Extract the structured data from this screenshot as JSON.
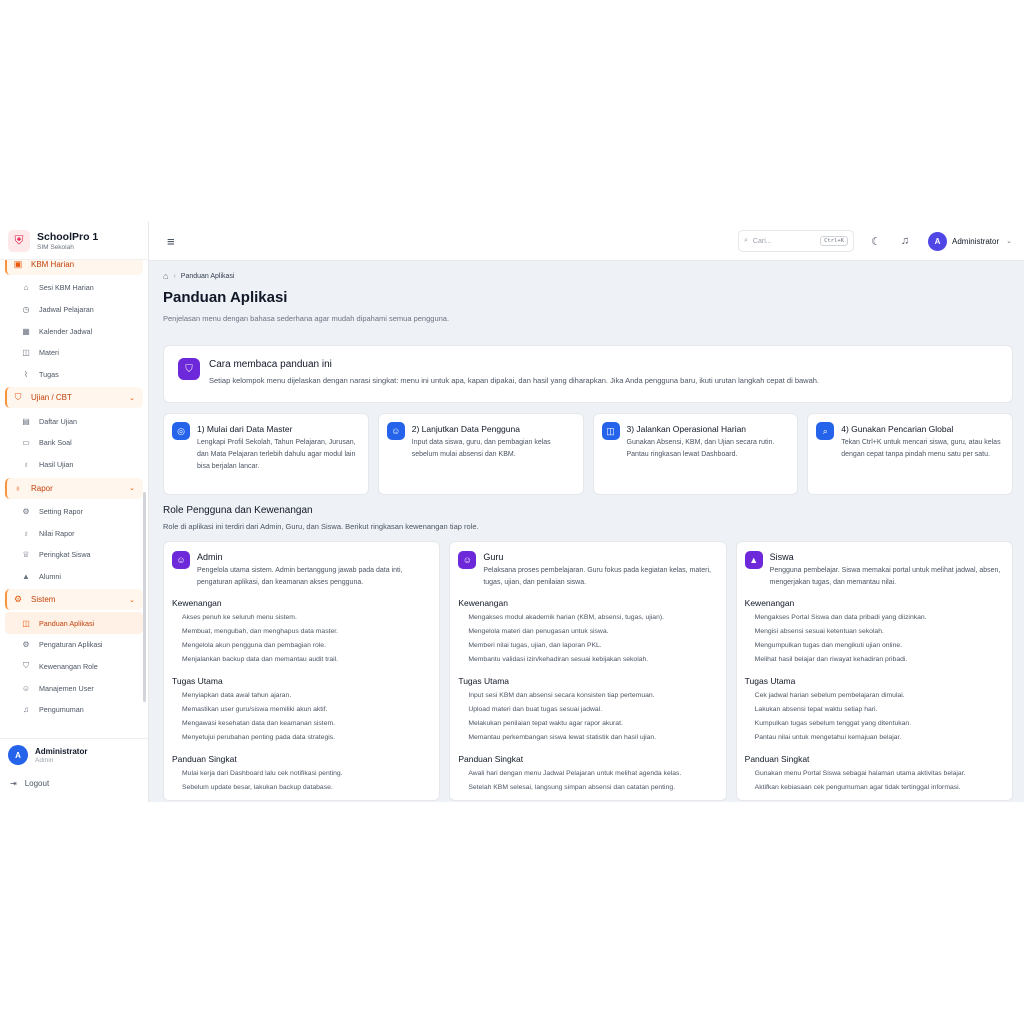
{
  "brand": {
    "title": "SchoolPro 1",
    "subtitle": "SIM Sekolah"
  },
  "sidebar": {
    "group_kbm": "KBM Harian",
    "kbm_items": [
      {
        "label": "Sesi KBM Harian",
        "icon": "home-icon"
      },
      {
        "label": "Jadwal Pelajaran",
        "icon": "clock-icon"
      },
      {
        "label": "Kalender Jadwal",
        "icon": "calendar-icon"
      },
      {
        "label": "Materi",
        "icon": "book-icon"
      },
      {
        "label": "Tugas",
        "icon": "paperclip-icon"
      }
    ],
    "group_ujian": "Ujian / CBT",
    "ujian_items": [
      {
        "label": "Daftar Ujian",
        "icon": "file-icon"
      },
      {
        "label": "Bank Soal",
        "icon": "folder-icon"
      },
      {
        "label": "Hasil Ujian",
        "icon": "award-icon"
      }
    ],
    "group_rapor": "Rapor",
    "rapor_items": [
      {
        "label": "Setting Rapor",
        "icon": "gear-icon"
      },
      {
        "label": "Nilai Rapor",
        "icon": "award-icon"
      },
      {
        "label": "Peringkat Siswa",
        "icon": "trophy-icon"
      },
      {
        "label": "Alumni",
        "icon": "graduation-icon"
      }
    ],
    "group_sistem": "Sistem",
    "sistem_items": [
      {
        "label": "Panduan Aplikasi",
        "icon": "book-icon"
      },
      {
        "label": "Pengaturan Aplikasi",
        "icon": "gear-icon"
      },
      {
        "label": "Kewenangan Role",
        "icon": "shield-icon"
      },
      {
        "label": "Manajemen User",
        "icon": "users-icon"
      },
      {
        "label": "Pengumuman",
        "icon": "bell-icon"
      }
    ],
    "user": {
      "initial": "A",
      "name": "Administrator",
      "role": "Admin"
    },
    "logout": "Logout"
  },
  "topbar": {
    "search_placeholder": "Cari...",
    "shortcut": "Ctrl+K",
    "user_initial": "A",
    "user_name": "Administrator"
  },
  "breadcrumb": {
    "current": "Panduan Aplikasi"
  },
  "page": {
    "title": "Panduan Aplikasi",
    "subtitle": "Penjelasan menu dengan bahasa sederhana agar mudah dipahami semua pengguna."
  },
  "intro": {
    "title": "Cara membaca panduan ini",
    "text": "Setiap kelompok menu dijelaskan dengan narasi singkat: menu ini untuk apa, kapan dipakai, dan hasil yang diharapkan. Jika Anda pengguna baru, ikuti urutan langkah cepat di bawah."
  },
  "steps": [
    {
      "title": "1) Mulai dari Data Master",
      "text": "Lengkapi Profil Sekolah, Tahun Pelajaran, Jurusan, dan Mata Pelajaran terlebih dahulu agar modul lain bisa berjalan lancar."
    },
    {
      "title": "2) Lanjutkan Data Pengguna",
      "text": "Input data siswa, guru, dan pembagian kelas sebelum mulai absensi dan KBM."
    },
    {
      "title": "3) Jalankan Operasional Harian",
      "text": "Gunakan Absensi, KBM, dan Ujian secara rutin. Pantau ringkasan lewat Dashboard."
    },
    {
      "title": "4) Gunakan Pencarian Global",
      "text": "Tekan Ctrl+K untuk mencari siswa, guru, atau kelas dengan cepat tanpa pindah menu satu per satu."
    }
  ],
  "roles_section": {
    "title": "Role Pengguna dan Kewenangan",
    "subtitle": "Role di aplikasi ini terdiri dari Admin, Guru, dan Siswa. Berikut ringkasan kewenangan tiap role."
  },
  "labels": {
    "kewenangan": "Kewenangan",
    "tugas": "Tugas Utama",
    "panduan": "Panduan Singkat"
  },
  "roles": [
    {
      "name": "Admin",
      "desc": "Pengelola utama sistem. Admin bertanggung jawab pada data inti, pengaturan aplikasi, dan keamanan akses pengguna.",
      "kewenangan": [
        "Akses penuh ke seluruh menu sistem.",
        "Membuat, mengubah, dan menghapus data master.",
        "Mengelola akun pengguna dan pembagian role.",
        "Menjalankan backup data dan memantau audit trail."
      ],
      "tugas": [
        "Menyiapkan data awal tahun ajaran.",
        "Memastikan user guru/siswa memiliki akun aktif.",
        "Mengawasi kesehatan data dan keamanan sistem.",
        "Menyetujui perubahan penting pada data strategis."
      ],
      "panduan": [
        "Mulai kerja dari Dashboard lalu cek notifikasi penting.",
        "Sebelum update besar, lakukan backup database."
      ]
    },
    {
      "name": "Guru",
      "desc": "Pelaksana proses pembelajaran. Guru fokus pada kegiatan kelas, materi, tugas, ujian, dan penilaian siswa.",
      "kewenangan": [
        "Mengakses modul akademik harian (KBM, absensi, tugas, ujian).",
        "Mengelola materi dan penugasan untuk siswa.",
        "Memberi nilai tugas, ujian, dan laporan PKL.",
        "Membantu validasi izin/kehadiran sesuai kebijakan sekolah."
      ],
      "tugas": [
        "Input sesi KBM dan absensi secara konsisten tiap pertemuan.",
        "Upload materi dan buat tugas sesuai jadwal.",
        "Melakukan penilaian tepat waktu agar rapor akurat.",
        "Memantau perkembangan siswa lewat statistik dan hasil ujian."
      ],
      "panduan": [
        "Awali hari dengan menu Jadwal Pelajaran untuk melihat agenda kelas.",
        "Setelah KBM selesai, langsung simpan absensi dan catatan penting."
      ]
    },
    {
      "name": "Siswa",
      "desc": "Pengguna pembelajar. Siswa memakai portal untuk melihat jadwal, absen, mengerjakan tugas, dan memantau nilai.",
      "kewenangan": [
        "Mengakses Portal Siswa dan data pribadi yang diizinkan.",
        "Mengisi absensi sesuai ketentuan sekolah.",
        "Mengumpulkan tugas dan mengikuti ujian online.",
        "Melihat hasil belajar dan riwayat kehadiran pribadi."
      ],
      "tugas": [
        "Cek jadwal harian sebelum pembelajaran dimulai.",
        "Lakukan absensi tepat waktu setiap hari.",
        "Kumpulkan tugas sebelum tenggat yang ditentukan.",
        "Pantau nilai untuk mengetahui kemajuan belajar."
      ],
      "panduan": [
        "Gunakan menu Portal Siswa sebagai halaman utama aktivitas belajar.",
        "Aktifkan kebiasaan cek pengumuman agar tidak tertinggal informasi."
      ]
    }
  ],
  "colors": {
    "accent": "#ea580c",
    "primary": "#2563eb",
    "role_icon": "#6d28d9",
    "background": "#eef1f6"
  }
}
